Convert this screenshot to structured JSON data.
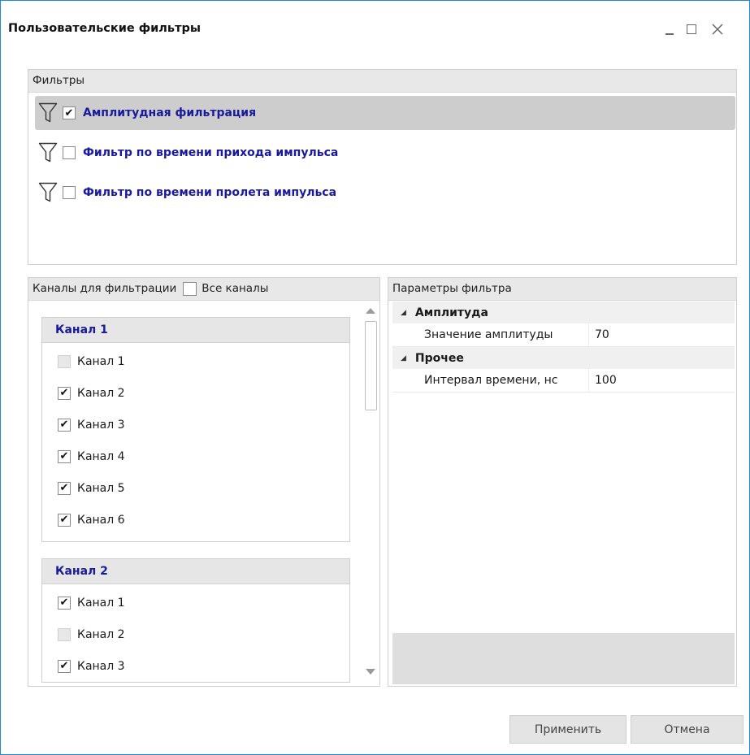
{
  "window": {
    "title": "Пользовательские фильтры",
    "controls": {
      "minimize": "_",
      "maximize": "□",
      "close": "X"
    }
  },
  "filters": {
    "header": "Фильтры",
    "items": [
      {
        "label": "Амплитудная фильтрация",
        "checked": true,
        "selected": true,
        "icon": "funnel-icon"
      },
      {
        "label": "Фильтр по времени прихода импульса",
        "checked": false,
        "selected": false,
        "icon": "funnel-icon"
      },
      {
        "label": "Фильтр по времени пролета импульса",
        "checked": false,
        "selected": false,
        "icon": "funnel-icon"
      }
    ]
  },
  "channels": {
    "header": "Каналы для фильтрации",
    "all_channels_label": "Все каналы",
    "all_channels_checked": false,
    "groups": [
      {
        "title": "Канал 1",
        "items": [
          {
            "label": "Канал 1",
            "checked": false,
            "disabled": true
          },
          {
            "label": "Канал 2",
            "checked": true,
            "disabled": false
          },
          {
            "label": "Канал 3",
            "checked": true,
            "disabled": false
          },
          {
            "label": "Канал 4",
            "checked": true,
            "disabled": false
          },
          {
            "label": "Канал 5",
            "checked": true,
            "disabled": false
          },
          {
            "label": "Канал 6",
            "checked": true,
            "disabled": false
          }
        ]
      },
      {
        "title": "Канал 2",
        "items": [
          {
            "label": "Канал 1",
            "checked": true,
            "disabled": false
          },
          {
            "label": "Канал 2",
            "checked": false,
            "disabled": true
          },
          {
            "label": "Канал 3",
            "checked": true,
            "disabled": false
          }
        ]
      }
    ]
  },
  "params": {
    "header": "Параметры фильтра",
    "categories": [
      {
        "name": "Амплитуда",
        "rows": [
          {
            "name": "Значение амплитуды",
            "value": "70"
          }
        ]
      },
      {
        "name": "Прочее",
        "rows": [
          {
            "name": "Интервал времени, нс",
            "value": "100"
          }
        ]
      }
    ]
  },
  "buttons": {
    "apply": "Применить",
    "cancel": "Отмена"
  },
  "colors": {
    "accent_border": "#1e8ad6",
    "label_blue": "#1a1a9e",
    "selected_row": "#cdcdcd"
  }
}
